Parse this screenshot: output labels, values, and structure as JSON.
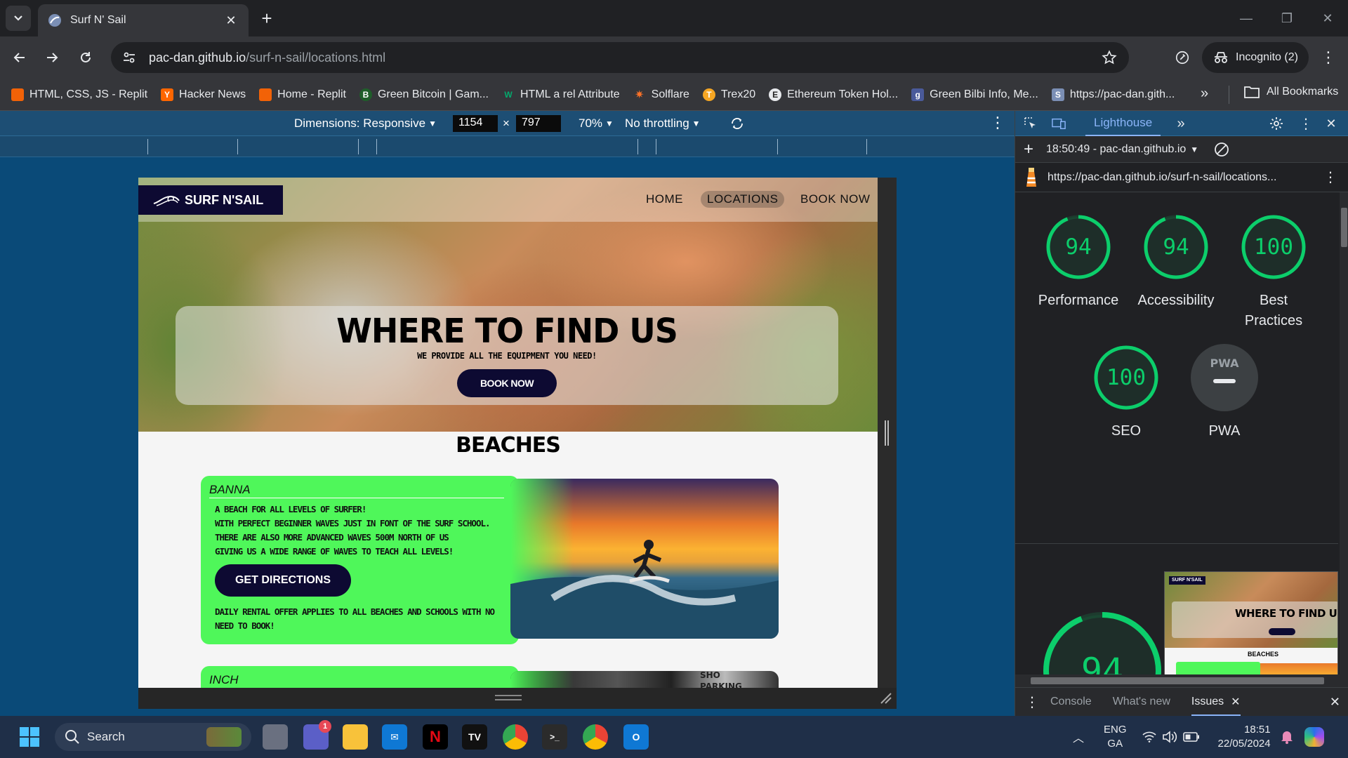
{
  "browser": {
    "tab_title": "Surf N' Sail",
    "url_host": "pac-dan.github.io",
    "url_path": "/surf-n-sail/locations.html",
    "incognito_label": "Incognito (2)",
    "bookmarks": [
      {
        "label": "HTML, CSS, JS - Replit",
        "icon": "replit-icon",
        "color": "#f26207"
      },
      {
        "label": "Hacker News",
        "icon": "hacker-news-icon",
        "color": "#ff6600",
        "glyph": "Y"
      },
      {
        "label": "Home - Replit",
        "icon": "replit-icon",
        "color": "#f26207"
      },
      {
        "label": "Green Bitcoin | Gam...",
        "icon": "green-bitcoin-icon",
        "color": "#1f5e2a",
        "glyph": "B"
      },
      {
        "label": "HTML a rel Attribute",
        "icon": "w3schools-icon",
        "color": "#04aa6d",
        "glyph": "W"
      },
      {
        "label": "Solflare",
        "icon": "solflare-icon",
        "color": "#fc7227",
        "glyph": "✷"
      },
      {
        "label": "Trex20",
        "icon": "trex20-icon",
        "color": "#f5a623",
        "glyph": "T"
      },
      {
        "label": "Ethereum Token Hol...",
        "icon": "etherscan-icon",
        "color": "#e8eaed",
        "glyph": "E"
      },
      {
        "label": "Green Bilbi Info, Me...",
        "icon": "green-bilbi-icon",
        "color": "#4a5a9a",
        "glyph": "g"
      },
      {
        "label": "https://pac-dan.gith...",
        "icon": "surf-favicon-icon",
        "color": "#7b8fb5",
        "glyph": "S"
      }
    ],
    "all_bookmarks_label": "All Bookmarks"
  },
  "device_toolbar": {
    "dimensions_label": "Dimensions: Responsive",
    "width": "1154",
    "times": "×",
    "height": "797",
    "zoom": "70%",
    "throttling": "No throttling"
  },
  "site": {
    "logo_text": "SURF N'SAIL",
    "nav": [
      "HOME",
      "LOCATIONS",
      "BOOK NOW"
    ],
    "hero_title": "WHERE TO FIND US",
    "hero_subtitle": "WE PROVIDE ALL THE EQUIPMENT YOU NEED!",
    "hero_button": "BOOK NOW",
    "section_title": "BEACHES",
    "cards": [
      {
        "name": "BANNA",
        "description": "A BEACH FOR ALL LEVELS OF SURFER!\nWITH PERFECT BEGINNER WAVES JUST IN FONT OF THE SURF SCHOOL.\nTHERE ARE ALSO MORE ADVANCED WAVES 500M NORTH OF US\nGIVING US A WIDE RANGE OF WAVES TO TEACH ALL LEVELS!",
        "button": "GET DIRECTIONS",
        "note": "DAILY RENTAL OFFER APPLIES TO ALL BEACHES AND SCHOOLS WITH NO NEED TO BOOK!"
      },
      {
        "name": "INCH"
      }
    ],
    "inch_image_text": "SHO\nPARKING"
  },
  "devtools": {
    "panel_tab": "Lighthouse",
    "report_time": "18:50:49 - pac-dan.github.io",
    "report_url": "https://pac-dan.github.io/surf-n-sail/locations...",
    "scores": [
      {
        "label": "Performance",
        "value": 94
      },
      {
        "label": "Accessibility",
        "value": 94
      },
      {
        "label": "Best Practices",
        "value": 100
      },
      {
        "label": "SEO",
        "value": 100
      }
    ],
    "pwa_label": "PWA",
    "pwa_badge": "PWA",
    "big_score": 94,
    "thumb_logo": "SURF N'SAIL",
    "thumb_title": "WHERE TO FIND U",
    "thumb_beaches": "BEACHES",
    "drawer_tabs": [
      "Console",
      "What's new",
      "Issues"
    ],
    "score_color": "#0cce6b"
  },
  "taskbar": {
    "search_label": "Search",
    "teams_badge": "1",
    "lang": "ENG",
    "region": "GA",
    "time": "18:51",
    "date": "22/05/2024"
  }
}
